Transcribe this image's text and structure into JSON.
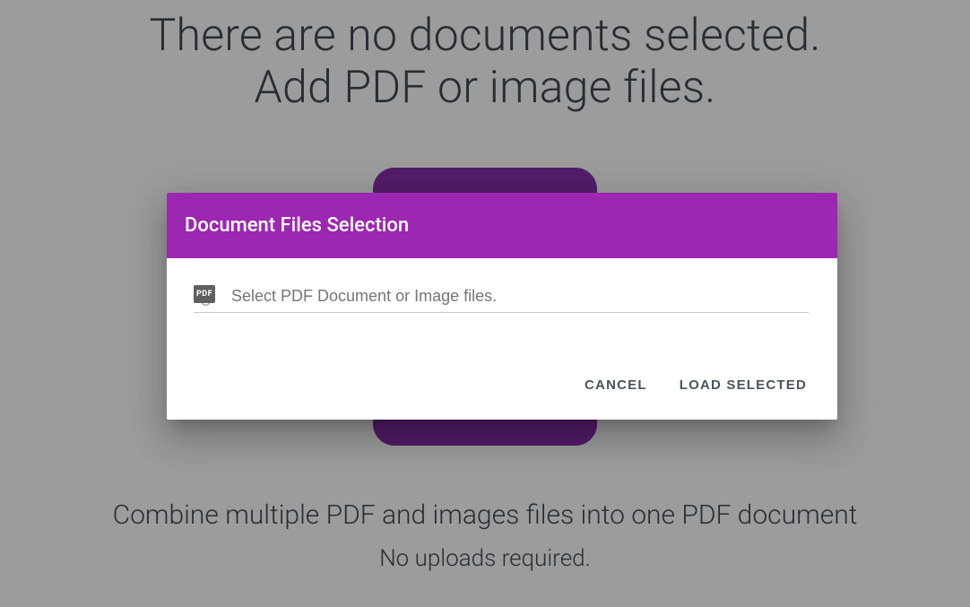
{
  "background": {
    "heading_line1": "There are no documents selected.",
    "heading_line2": "Add PDF or image files.",
    "subtext_line1": "Combine multiple PDF and images files into one PDF document",
    "subtext_line2": "No uploads required."
  },
  "dialog": {
    "title": "Document Files Selection",
    "pdf_badge": "PDF",
    "input_placeholder": "Select PDF Document or Image files.",
    "cancel_label": "CANCEL",
    "load_label": "LOAD SELECTED"
  }
}
